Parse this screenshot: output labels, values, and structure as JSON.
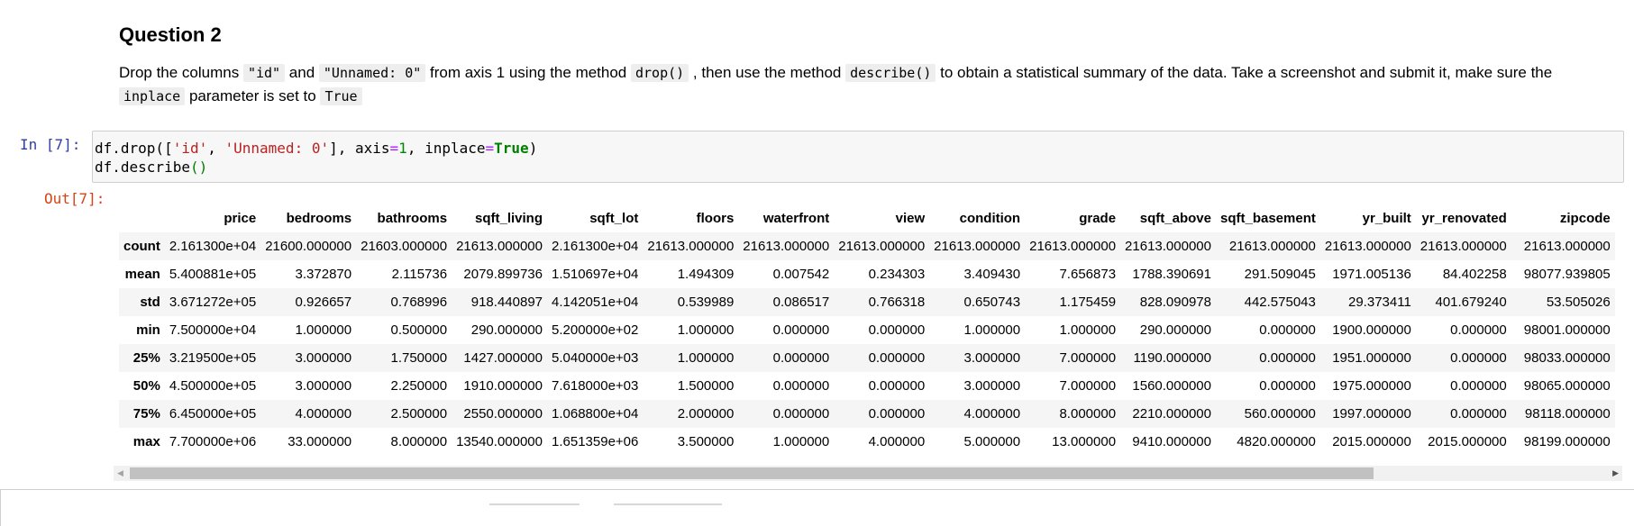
{
  "question": {
    "title": "Question 2",
    "text_1": "Drop the columns ",
    "code_id": "\"id\"",
    "text_2": " and ",
    "code_unnamed": "\"Unnamed: 0\"",
    "text_3": " from axis 1 using the method ",
    "code_drop": "drop()",
    "text_4": " , then use the method ",
    "code_describe": "describe()",
    "text_5": " to obtain a statistical summary of the data. Take a screenshot and submit it, make sure the ",
    "code_inplace": "inplace",
    "text_6": " parameter is set to ",
    "code_true": "True"
  },
  "cell": {
    "in_prompt": "In [7]:",
    "out_prompt": "Out[7]:",
    "code": {
      "l1_a": "df.drop([",
      "l1_str1": "'id'",
      "l1_b": ", ",
      "l1_str2": "'Unnamed: 0'",
      "l1_c": "], axis",
      "l1_eq1": "=",
      "l1_num": "1",
      "l1_d": ", inplace",
      "l1_eq2": "=",
      "l1_kw": "True",
      "l1_e": ")",
      "l2_a": "df.describe",
      "l2_par": "()"
    }
  },
  "table": {
    "columns": [
      "price",
      "bedrooms",
      "bathrooms",
      "sqft_living",
      "sqft_lot",
      "floors",
      "waterfront",
      "view",
      "condition",
      "grade",
      "sqft_above",
      "sqft_basement",
      "yr_built",
      "yr_renovated",
      "zipcode"
    ],
    "rows": [
      {
        "label": "count",
        "values": [
          "2.161300e+04",
          "21600.000000",
          "21603.000000",
          "21613.000000",
          "2.161300e+04",
          "21613.000000",
          "21613.000000",
          "21613.000000",
          "21613.000000",
          "21613.000000",
          "21613.000000",
          "21613.000000",
          "21613.000000",
          "21613.000000",
          "21613.000000"
        ]
      },
      {
        "label": "mean",
        "values": [
          "5.400881e+05",
          "3.372870",
          "2.115736",
          "2079.899736",
          "1.510697e+04",
          "1.494309",
          "0.007542",
          "0.234303",
          "3.409430",
          "7.656873",
          "1788.390691",
          "291.509045",
          "1971.005136",
          "84.402258",
          "98077.939805"
        ]
      },
      {
        "label": "std",
        "values": [
          "3.671272e+05",
          "0.926657",
          "0.768996",
          "918.440897",
          "4.142051e+04",
          "0.539989",
          "0.086517",
          "0.766318",
          "0.650743",
          "1.175459",
          "828.090978",
          "442.575043",
          "29.373411",
          "401.679240",
          "53.505026"
        ]
      },
      {
        "label": "min",
        "values": [
          "7.500000e+04",
          "1.000000",
          "0.500000",
          "290.000000",
          "5.200000e+02",
          "1.000000",
          "0.000000",
          "0.000000",
          "1.000000",
          "1.000000",
          "290.000000",
          "0.000000",
          "1900.000000",
          "0.000000",
          "98001.000000"
        ]
      },
      {
        "label": "25%",
        "values": [
          "3.219500e+05",
          "3.000000",
          "1.750000",
          "1427.000000",
          "5.040000e+03",
          "1.000000",
          "0.000000",
          "0.000000",
          "3.000000",
          "7.000000",
          "1190.000000",
          "0.000000",
          "1951.000000",
          "0.000000",
          "98033.000000"
        ]
      },
      {
        "label": "50%",
        "values": [
          "4.500000e+05",
          "3.000000",
          "2.250000",
          "1910.000000",
          "7.618000e+03",
          "1.500000",
          "0.000000",
          "0.000000",
          "3.000000",
          "7.000000",
          "1560.000000",
          "0.000000",
          "1975.000000",
          "0.000000",
          "98065.000000"
        ]
      },
      {
        "label": "75%",
        "values": [
          "6.450000e+05",
          "4.000000",
          "2.500000",
          "2550.000000",
          "1.068800e+04",
          "2.000000",
          "0.000000",
          "0.000000",
          "4.000000",
          "8.000000",
          "2210.000000",
          "560.000000",
          "1997.000000",
          "0.000000",
          "98118.000000"
        ]
      },
      {
        "label": "max",
        "values": [
          "7.700000e+06",
          "33.000000",
          "8.000000",
          "13540.000000",
          "1.651359e+06",
          "3.500000",
          "1.000000",
          "4.000000",
          "5.000000",
          "13.000000",
          "9410.000000",
          "4820.000000",
          "2015.000000",
          "2015.000000",
          "98199.000000"
        ]
      }
    ]
  },
  "scrollbar": {
    "left_arrow": "◀",
    "right_arrow": "▶"
  }
}
